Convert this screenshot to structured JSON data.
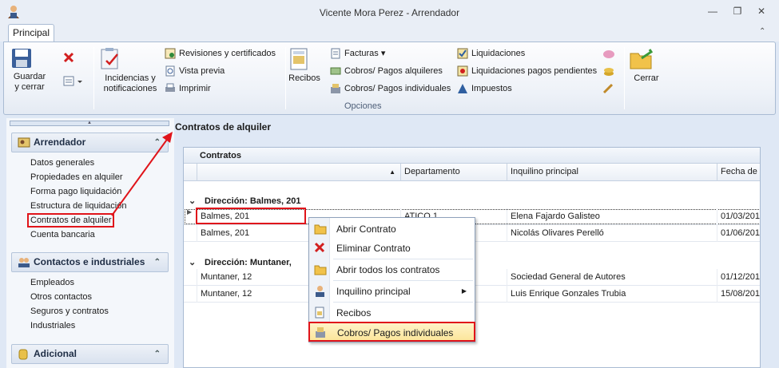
{
  "window": {
    "title": "Vicente Mora Perez - Arrendador"
  },
  "ribbon": {
    "tab": "Principal",
    "save_close": "Guardar\ny cerrar",
    "incidencias": "Incidencias y\nnotificaciones",
    "revisiones": "Revisiones y certificados",
    "vista_previa": "Vista previa",
    "imprimir": "Imprimir",
    "recibos": "Recibos",
    "facturas": "Facturas",
    "cobros_alquileres": "Cobros/ Pagos alquileres",
    "cobros_individuales": "Cobros/ Pagos individuales",
    "liquidaciones": "Liquidaciones",
    "liquidaciones_pendientes": "Liquidaciones pagos pendientes",
    "impuestos": "Impuestos",
    "cerrar": "Cerrar",
    "group_opciones": "Opciones"
  },
  "sidebar": {
    "sections": [
      {
        "title": "Arrendador",
        "items": [
          "Datos generales",
          "Propiedades en alquiler",
          "Forma pago liquidación",
          "Estructura de liquidación",
          "Contratos de alquiler",
          "Cuenta bancaria"
        ]
      },
      {
        "title": "Contactos e industriales",
        "items": [
          "Empleados",
          "Otros contactos",
          "Seguros y contratos",
          "Industriales"
        ]
      },
      {
        "title": "Adicional",
        "items": []
      }
    ]
  },
  "content": {
    "title": "Contratos de alquiler",
    "grid_title": "Contratos",
    "columns": [
      "Departamento",
      "Inquilino principal",
      "Fecha de i"
    ],
    "groups": [
      {
        "label": "Dirección: Balmes, 201",
        "rows": [
          {
            "direccion": "Balmes, 201",
            "departamento": "ATICO 1",
            "inquilino": "Elena Fajardo Galisteo",
            "fecha": "01/03/201"
          },
          {
            "direccion": "Balmes, 201",
            "departamento": "",
            "inquilino": "Nicolás Olivares Perelló",
            "fecha": "01/06/201"
          }
        ]
      },
      {
        "label": "Dirección: Muntaner, 12",
        "rows": [
          {
            "direccion": "Muntaner, 12",
            "departamento": "",
            "inquilino": "Sociedad General de Autores",
            "fecha": "01/12/201"
          },
          {
            "direccion": "Muntaner, 12",
            "departamento": "",
            "inquilino": "Luis Enrique Gonzales Trubia",
            "fecha": "15/08/201"
          }
        ]
      }
    ],
    "group2_visible": "Dirección: Muntaner,"
  },
  "context_menu": {
    "items": [
      "Abrir Contrato",
      "Eliminar Contrato",
      "Abrir todos los contratos",
      "Inquilino principal",
      "Recibos",
      "Cobros/ Pagos individuales"
    ]
  }
}
